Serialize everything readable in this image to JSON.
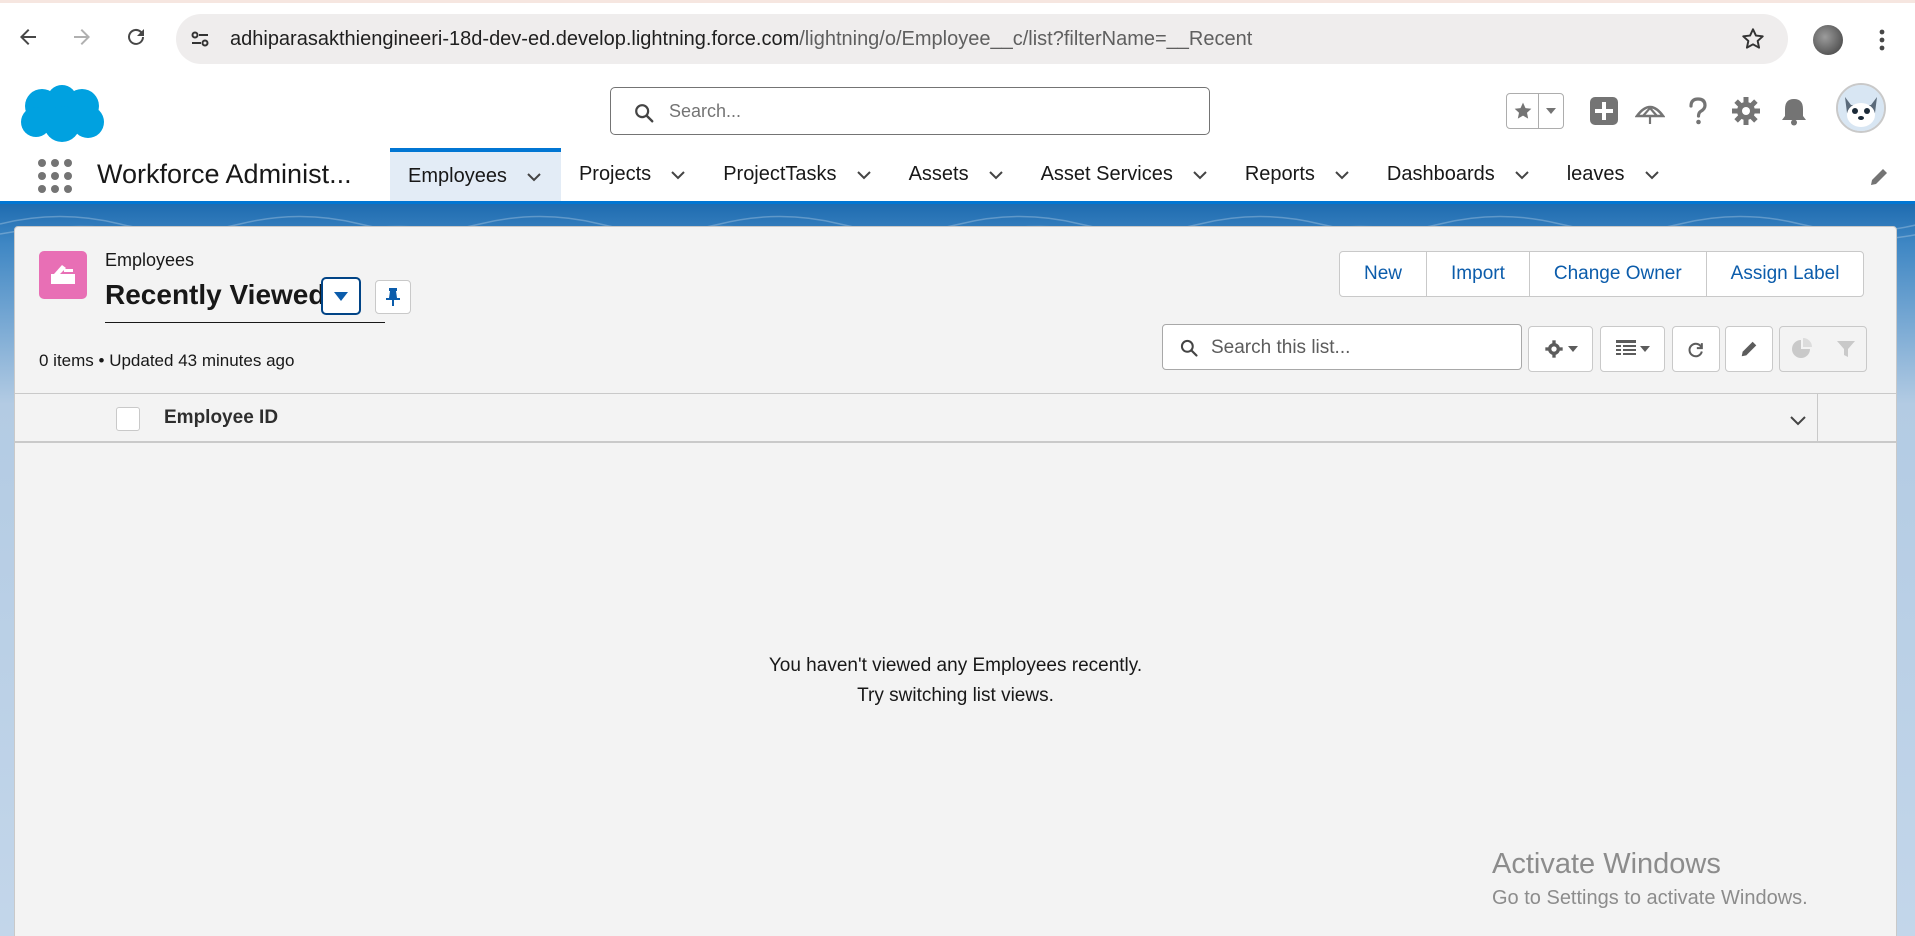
{
  "browser": {
    "url_host": "adhiparasakthiengineeri-18d-dev-ed.develop.lightning.force.com",
    "url_path": "/lightning/o/Employee__c/list?filterName=__Recent"
  },
  "header": {
    "search_placeholder": "Search..."
  },
  "appnav": {
    "app_name": "Workforce Administ...",
    "tabs": [
      {
        "label": "Employees",
        "active": true
      },
      {
        "label": "Projects"
      },
      {
        "label": "ProjectTasks"
      },
      {
        "label": "Assets"
      },
      {
        "label": "Asset Services"
      },
      {
        "label": "Reports"
      },
      {
        "label": "Dashboards"
      },
      {
        "label": "leaves"
      }
    ]
  },
  "list": {
    "object_label": "Employees",
    "view_name": "Recently Viewed",
    "meta": "0 items • Updated 43 minutes ago",
    "actions": [
      "New",
      "Import",
      "Change Owner",
      "Assign Label"
    ],
    "search_placeholder": "Search this list...",
    "column_header": "Employee ID",
    "empty_line1": "You haven't viewed any Employees recently.",
    "empty_line2": "Try switching list views."
  },
  "watermark": {
    "line1": "Activate Windows",
    "line2": "Go to Settings to activate Windows."
  },
  "colors": {
    "brand_blue": "#0176d3",
    "link_blue": "#0b5cab",
    "object_icon_pink": "#e86fb5",
    "cloud_blue": "#00a1e0"
  }
}
